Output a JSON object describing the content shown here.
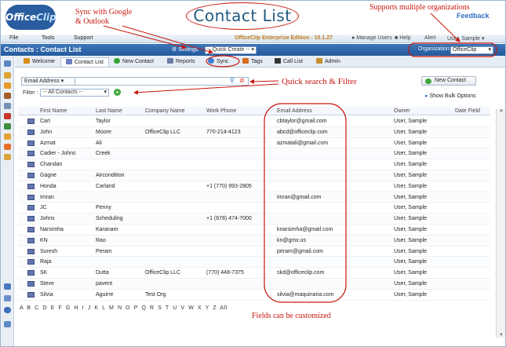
{
  "logo": {
    "text_main": "Office",
    "text_accent": "Clip"
  },
  "feedback": "Feedback",
  "menubar": {
    "items": [
      "File",
      "Tools",
      "Support"
    ],
    "edition": "OfficeClip Enterprise Edition - 10.1.27",
    "right_items": [
      "Manage Users",
      "Help",
      "Alert",
      "User, Sample"
    ]
  },
  "titlebar": {
    "title": "Contacts : Contact List",
    "settings": "Settings",
    "quick_create": "-- Quick Create --",
    "org_label": "Organization:",
    "org_value": "OfficeClip"
  },
  "tabs": [
    {
      "label": "Welcome",
      "icon": "home-icon",
      "color": "#d98b1a"
    },
    {
      "label": "Contact List",
      "icon": "contacts-icon",
      "color": "#6a7fbf"
    },
    {
      "label": "New Contact",
      "icon": "add-icon",
      "color": "#36a336"
    },
    {
      "label": "Reports",
      "icon": "report-icon",
      "color": "#6c7da6"
    },
    {
      "label": "Sync",
      "icon": "sync-icon",
      "color": "#3a7fd0"
    },
    {
      "label": "Tags",
      "icon": "tag-icon",
      "color": "#d96b1f"
    },
    {
      "label": "Call List",
      "icon": "phone-icon",
      "color": "#333333"
    },
    {
      "label": "Admin",
      "icon": "admin-icon",
      "color": "#c0902a"
    }
  ],
  "search": {
    "field": "Email Address",
    "filter_label": "Filter :",
    "filter_value": "-- All Contacts --"
  },
  "buttons": {
    "new_contact": "New Contact",
    "show_bulk": "Show Bulk Options"
  },
  "table": {
    "headers": [
      "First Name",
      "Last Name",
      "Company Name",
      "Work Phone",
      "Email Address",
      "Owner",
      "Date Field"
    ],
    "rows": [
      [
        "Carl",
        "Taylor",
        "",
        "",
        "cbtaylor@gmail.com",
        "User, Sample",
        ""
      ],
      [
        "John",
        "Moore",
        "OfficeClip LLC",
        "770-214-4123",
        "abcd@officeclip.com",
        "User, Sample",
        ""
      ],
      [
        "Azmat",
        "Ali",
        "",
        "",
        "azmatali@gmail.com",
        "User, Sample",
        ""
      ],
      [
        "Cadier - Johns",
        "Creek",
        "",
        "",
        "",
        "User, Sample",
        ""
      ],
      [
        "Chandan",
        "",
        "",
        "",
        "",
        "User, Sample",
        ""
      ],
      [
        "Gagne",
        "Aircondition",
        "",
        "",
        "",
        "User, Sample",
        ""
      ],
      [
        "Honda",
        "Carland",
        "",
        "+1 (770) 993-2805",
        "",
        "User, Sample",
        ""
      ],
      [
        "Imran",
        "",
        "",
        "",
        "imran@gmail.com",
        "User, Sample",
        ""
      ],
      [
        "JC",
        "Penny",
        "",
        "",
        "",
        "User, Sample",
        ""
      ],
      [
        "Johns",
        "Scheduling",
        "",
        "+1 (678) 474-7000",
        "",
        "User, Sample",
        ""
      ],
      [
        "Narsimha",
        "Karanam",
        "",
        "",
        "knarsimha@gmail.com",
        "User, Sample",
        ""
      ],
      [
        "KN",
        "Rao",
        "",
        "",
        "kn@gmx.us",
        "User, Sample",
        ""
      ],
      [
        "Suresh",
        "Peram",
        "",
        "",
        "peram@gmail.com",
        "User, Sample",
        ""
      ],
      [
        "Raja",
        "",
        "",
        "",
        "",
        "User, Sample",
        ""
      ],
      [
        "SK",
        "Dutta",
        "OfficeClip LLC",
        "(770) 448-7375",
        "skd@officeclip.com",
        "User, Sample",
        ""
      ],
      [
        "Steve",
        "pavent",
        "",
        "",
        "",
        "User, Sample",
        ""
      ],
      [
        "Silvia",
        "Aguirre",
        "Test Org",
        "",
        "silvia@maquinaria.com",
        "User, Sample",
        ""
      ]
    ]
  },
  "alphabet": "A B C D E F G H I J K L M N O P Q R S T U V W X Y Z All",
  "annotations": {
    "contact_list": "Contact List",
    "sync_line1": "Sync with Google",
    "sync_line2": "& Outlook",
    "multi_org": "Supports multiple organizations",
    "quick_search": "Quick search & Filter",
    "customized": "Fields can be customized"
  },
  "colors": {
    "accent": "#2a5d9f",
    "annotation": "#c8170d",
    "titlebar": "#2e65a6"
  }
}
